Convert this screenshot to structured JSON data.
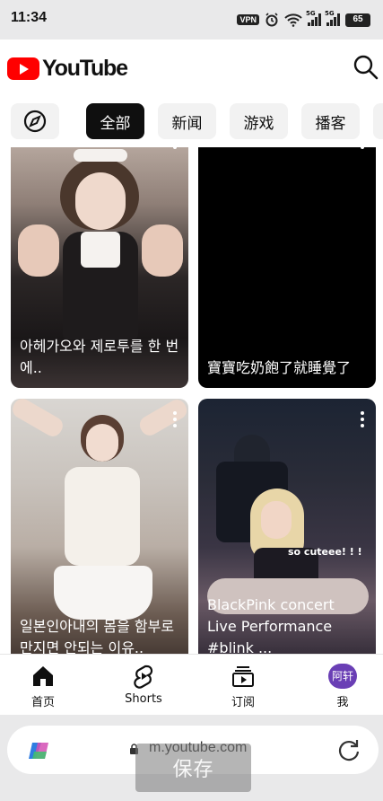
{
  "status_bar": {
    "time": "11:34",
    "vpn": "VPN",
    "network_1": "5G",
    "network_2": "5G",
    "battery": "65"
  },
  "header": {
    "logo_text": "YouTube",
    "brand_color": "#ff0000"
  },
  "chips": [
    {
      "label": "全部",
      "active": true
    },
    {
      "label": "新闻",
      "active": false
    },
    {
      "label": "游戏",
      "active": false
    },
    {
      "label": "播客",
      "active": false
    }
  ],
  "shorts": [
    {
      "title": "아헤가오와 제로투를 한 번에.."
    },
    {
      "title": "寶寶吃奶飽了就睡覺了"
    },
    {
      "title": "일본인아내의 몸을 함부로 만지면 안되는 이유.."
    },
    {
      "title": "BlackPink concert Live Performance #blink ..."
    }
  ],
  "overlay_text": "so cuteee! ! !",
  "bottom_nav": {
    "home": "首页",
    "shorts": "Shorts",
    "subscriptions": "订阅",
    "you": "我",
    "avatar_text": "阿轩",
    "avatar_color": "#6a3fb5"
  },
  "browser": {
    "url": "m.youtube.com",
    "save_label": "保存"
  }
}
